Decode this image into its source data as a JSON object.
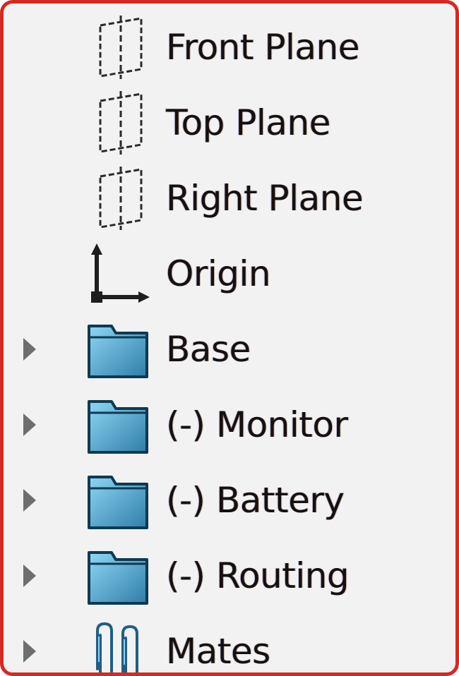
{
  "tree": {
    "items": [
      {
        "label": "Front Plane",
        "icon": "plane-icon",
        "expandable": false
      },
      {
        "label": "Top Plane",
        "icon": "plane-icon",
        "expandable": false
      },
      {
        "label": "Right Plane",
        "icon": "plane-icon",
        "expandable": false
      },
      {
        "label": "Origin",
        "icon": "origin-icon",
        "expandable": false
      },
      {
        "label": "Base",
        "icon": "folder-icon",
        "expandable": true
      },
      {
        "label": "(-) Monitor",
        "icon": "folder-icon",
        "expandable": true
      },
      {
        "label": "(-) Battery",
        "icon": "folder-icon",
        "expandable": true
      },
      {
        "label": "(-) Routing",
        "icon": "folder-icon",
        "expandable": true
      },
      {
        "label": "Mates",
        "icon": "paperclip-icon",
        "expandable": true
      }
    ]
  },
  "colors": {
    "border": "#d42a22",
    "background": "#f2f2f2",
    "text": "#161010",
    "folder_fill": "#5ab0d8",
    "folder_outline": "#0e3a52",
    "expander": "#6e6e6e"
  }
}
